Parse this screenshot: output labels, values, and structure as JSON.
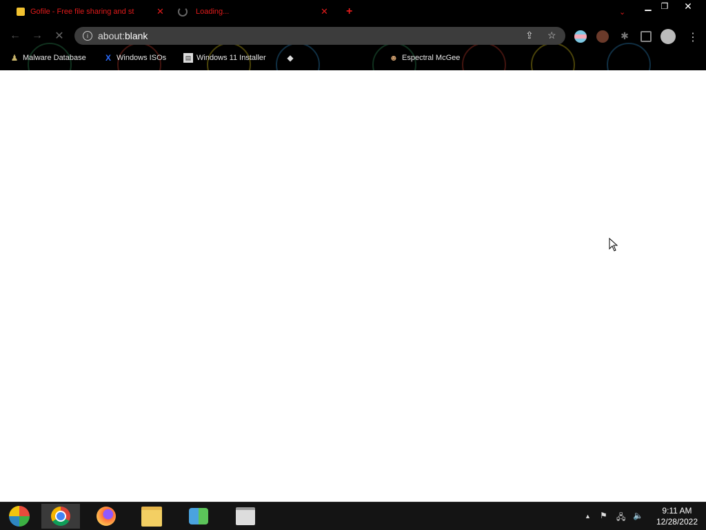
{
  "tabs": [
    {
      "title": "Gofile - Free file sharing and st",
      "active": true,
      "icon": "gofile-favicon"
    },
    {
      "title": "Loading...",
      "active": false,
      "icon": "loading-spinner-icon"
    }
  ],
  "new_tab_glyph": "+",
  "omnibox": {
    "scheme": "about:",
    "host": "blank"
  },
  "bookmarks": [
    {
      "label": "Malware Database",
      "icon": "person-icon"
    },
    {
      "label": "Windows ISOs",
      "icon": "x-logo-icon"
    },
    {
      "label": "Windows 11 Installer",
      "icon": "page-icon"
    },
    {
      "label": "",
      "icon": "site-favicon"
    },
    {
      "label": "Espectral McGee",
      "icon": "face-favicon"
    }
  ],
  "clock": {
    "time": "9:11 AM",
    "date": "12/28/2022"
  },
  "colors": {
    "tab_text": "#e31b1b",
    "chrome_bg": "#000000",
    "omnibox_bg": "#3c3c3c",
    "taskbar_bg": "#141414"
  }
}
